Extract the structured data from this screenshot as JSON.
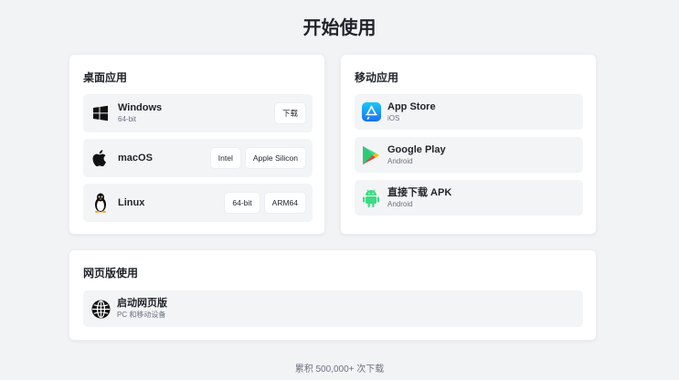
{
  "page": {
    "title": "开始使用"
  },
  "desktop": {
    "title": "桌面应用",
    "windows": {
      "name": "Windows",
      "sub": "64-bit",
      "button": "下载"
    },
    "macos": {
      "name": "macOS",
      "buttons": [
        "Intel",
        "Apple Silicon"
      ]
    },
    "linux": {
      "name": "Linux",
      "buttons": [
        "64-bit",
        "ARM64"
      ]
    }
  },
  "mobile": {
    "title": "移动应用",
    "appstore": {
      "name": "App Store",
      "sub": "iOS"
    },
    "googleplay": {
      "name": "Google Play",
      "sub": "Android"
    },
    "apk": {
      "name": "直接下载 APK",
      "sub": "Android"
    }
  },
  "web": {
    "title": "网页版使用",
    "launch": {
      "name": "启动网页版",
      "sub": "PC 和移动设备"
    }
  },
  "footer": {
    "text": "累积 500,000+ 次下载"
  },
  "colors": {
    "appstore": "#1d8cf8",
    "android": "#3ddc84",
    "background": "#f2f3f5"
  }
}
